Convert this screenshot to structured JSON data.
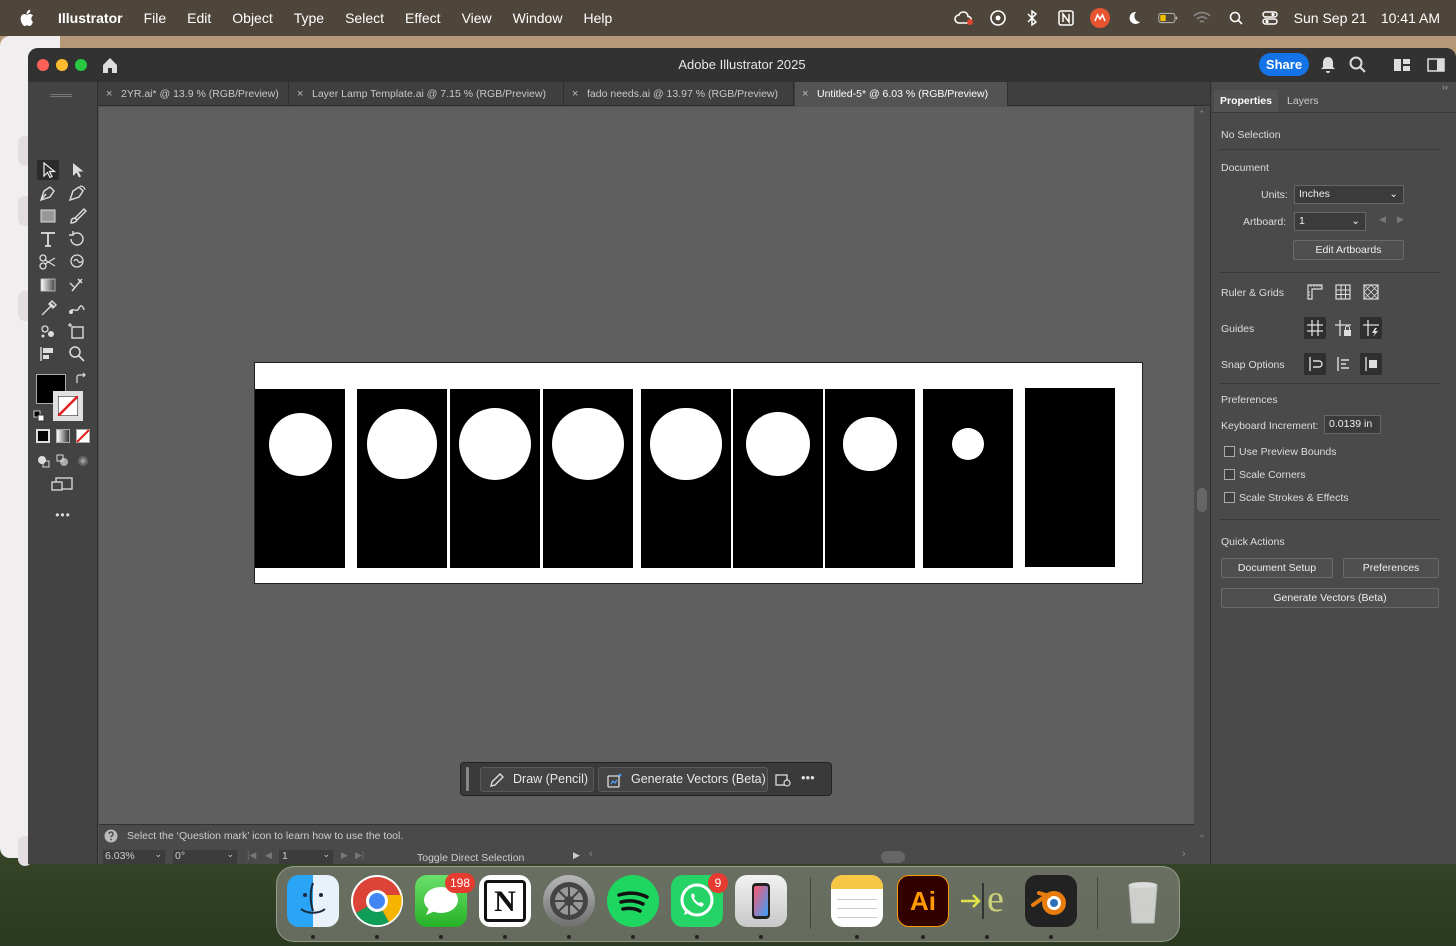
{
  "menubar": {
    "app_name": "Illustrator",
    "items": [
      "File",
      "Edit",
      "Object",
      "Type",
      "Select",
      "Effect",
      "View",
      "Window",
      "Help"
    ],
    "date": "Sun Sep 21",
    "time": "10:41 AM"
  },
  "window": {
    "title": "Adobe Illustrator 2025",
    "share_label": "Share"
  },
  "tabs": [
    {
      "label": "2YR.ai* @ 13.9 % (RGB/Preview)",
      "active": false
    },
    {
      "label": "Layer Lamp Template.ai @ 7.15 % (RGB/Preview)",
      "active": false
    },
    {
      "label": "fado needs.ai @ 13.97 % (RGB/Preview)",
      "active": false
    },
    {
      "label": "Untitled-5* @ 6.03 % (RGB/Preview)",
      "active": true
    }
  ],
  "tab_close_glyph": "×",
  "context_bar": {
    "draw_label": "Draw (Pencil)",
    "generate_label": "Generate Vectors (Beta)",
    "more_glyph": "•••"
  },
  "status": {
    "hint": "Select the ‘Question mark’ icon to learn how to use the tool.",
    "zoom": "6.03%",
    "rotation": "0°",
    "artboard": "1",
    "tool_name": "Toggle Direct Selection"
  },
  "properties": {
    "tab_properties": "Properties",
    "tab_layers": "Layers",
    "selection": "No Selection",
    "document_heading": "Document",
    "units_label": "Units:",
    "units_value": "Inches",
    "artboard_label": "Artboard:",
    "artboard_value": "1",
    "edit_artboards": "Edit Artboards",
    "ruler_grids": "Ruler & Grids",
    "guides": "Guides",
    "snap_options": "Snap Options",
    "preferences_heading": "Preferences",
    "keyboard_increment_label": "Keyboard Increment:",
    "keyboard_increment_value": "0.0139 in",
    "use_preview_bounds": "Use Preview Bounds",
    "scale_corners": "Scale Corners",
    "scale_strokes": "Scale Strokes & Effects",
    "quick_actions_heading": "Quick Actions",
    "document_setup": "Document Setup",
    "preferences_button": "Preferences",
    "generate_vectors": "Generate Vectors (Beta)"
  },
  "toolbar_more_glyph": "•••",
  "artwork": {
    "panels": [
      {
        "circle_diameter_rel": 0.7
      },
      {
        "circle_diameter_rel": 0.77
      },
      {
        "circle_diameter_rel": 0.81
      },
      {
        "circle_diameter_rel": 0.81
      },
      {
        "circle_diameter_rel": 0.79
      },
      {
        "circle_diameter_rel": 0.71
      },
      {
        "circle_diameter_rel": 0.59
      },
      {
        "circle_diameter_rel": 0.36
      },
      {
        "circle_diameter_rel": 0
      }
    ]
  },
  "dock": {
    "apps": [
      "finder-icon",
      "chrome-icon",
      "messages-icon",
      "notion-icon",
      "system-settings-icon",
      "spotify-icon",
      "whatsapp-icon",
      "iphone-mirroring-icon",
      "notes-icon",
      "illustrator-icon",
      "editor-icon",
      "blender-icon",
      "trash-icon"
    ],
    "messages_badge": "198",
    "whatsapp_badge": "9",
    "illustrator_label": "Ai",
    "notion_label": "N",
    "editor_label": "e"
  },
  "colors": {
    "accent_blue": "#1473e6",
    "menubar_bg": "#3c3730",
    "window_chrome": "#323232",
    "panel_bg": "#4a4a4a",
    "canvas_bg": "#5f5f5f"
  }
}
